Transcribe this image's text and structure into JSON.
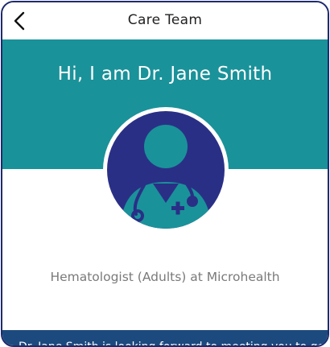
{
  "header": {
    "title": "Care Team"
  },
  "hero": {
    "greeting": "Hi, I am Dr. Jane Smith"
  },
  "profile": {
    "role": "Hematologist (Adults) at Microhealth"
  },
  "bio": {
    "partial_text": "Dr. Jane Smith is looking forward to meeting you to get"
  },
  "colors": {
    "frame_border": "#1e2a6e",
    "hero_teal": "#1a929a",
    "avatar_navy": "#2a2f86",
    "bottom_band": "#1c4a7e"
  },
  "icons": {
    "back": "chevron-left-icon",
    "avatar": "doctor-avatar-icon"
  }
}
